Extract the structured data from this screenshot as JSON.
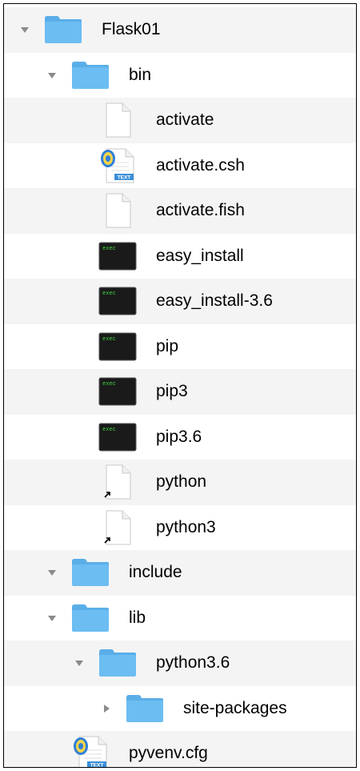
{
  "tree": [
    {
      "label": "Flask01",
      "icon": "folder-icon",
      "level": 0,
      "disclosure": "expanded"
    },
    {
      "label": "bin",
      "icon": "folder-icon",
      "level": 1,
      "disclosure": "expanded"
    },
    {
      "label": "activate",
      "icon": "document-icon",
      "level": 2,
      "disclosure": "none"
    },
    {
      "label": "activate.csh",
      "icon": "text-document-icon",
      "level": 2,
      "disclosure": "none"
    },
    {
      "label": "activate.fish",
      "icon": "document-icon",
      "level": 2,
      "disclosure": "none"
    },
    {
      "label": "easy_install",
      "icon": "exec-icon",
      "level": 2,
      "disclosure": "none"
    },
    {
      "label": "easy_install-3.6",
      "icon": "exec-icon",
      "level": 2,
      "disclosure": "none"
    },
    {
      "label": "pip",
      "icon": "exec-icon",
      "level": 2,
      "disclosure": "none"
    },
    {
      "label": "pip3",
      "icon": "exec-icon",
      "level": 2,
      "disclosure": "none"
    },
    {
      "label": "pip3.6",
      "icon": "exec-icon",
      "level": 2,
      "disclosure": "none"
    },
    {
      "label": "python",
      "icon": "alias-document-icon",
      "level": 2,
      "disclosure": "none"
    },
    {
      "label": "python3",
      "icon": "alias-document-icon",
      "level": 2,
      "disclosure": "none"
    },
    {
      "label": "include",
      "icon": "folder-icon",
      "level": 1,
      "disclosure": "collapsed-down"
    },
    {
      "label": "lib",
      "icon": "folder-icon",
      "level": 1,
      "disclosure": "expanded"
    },
    {
      "label": "python3.6",
      "icon": "folder-icon",
      "level": 2,
      "disclosure": "expanded"
    },
    {
      "label": "site-packages",
      "icon": "folder-icon",
      "level": 3,
      "disclosure": "collapsed"
    },
    {
      "label": "pyvenv.cfg",
      "icon": "text-document-icon",
      "level": 1,
      "disclosure": "none"
    }
  ],
  "exec_badge": "exec",
  "text_badge": "TEXT",
  "colors": {
    "folder": "#6cbdf2",
    "folder_tab": "#5aaee8",
    "alt_row": "#f4f4f4",
    "exec_bg": "#1a1a1a",
    "exec_text": "#3fd13f",
    "disclosure": "#8a8a8a"
  }
}
